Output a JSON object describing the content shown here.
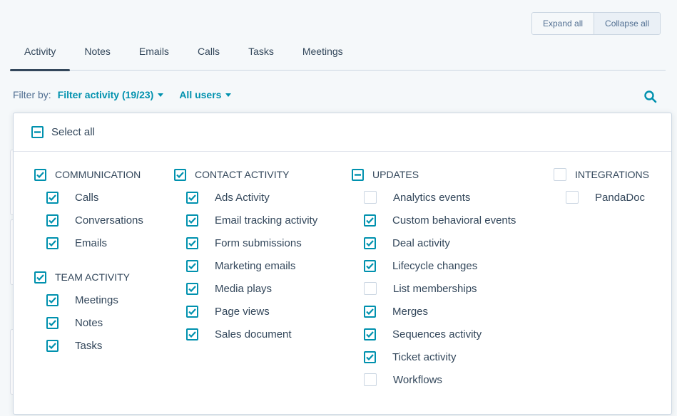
{
  "header": {
    "expand_all": "Expand all",
    "collapse_all": "Collapse all"
  },
  "tabs": [
    {
      "label": "Activity",
      "active": true
    },
    {
      "label": "Notes"
    },
    {
      "label": "Emails"
    },
    {
      "label": "Calls"
    },
    {
      "label": "Tasks"
    },
    {
      "label": "Meetings"
    }
  ],
  "filter": {
    "label": "Filter by:",
    "activity": "Filter activity (19/23)",
    "users": "All users"
  },
  "icons": {
    "search": "search-icon",
    "checked": "checkmark-icon",
    "partial": "minus-icon"
  },
  "colors": {
    "accent": "#0091ae",
    "text": "#33475b",
    "border": "#cbd6e2"
  },
  "panel": {
    "select_all": {
      "label": "Select all",
      "state": "partial"
    },
    "groups": {
      "communication": {
        "title": "COMMUNICATION",
        "state": "checked",
        "items": [
          {
            "label": "Calls",
            "checked": true
          },
          {
            "label": "Conversations",
            "checked": true
          },
          {
            "label": "Emails",
            "checked": true
          }
        ]
      },
      "team_activity": {
        "title": "TEAM ACTIVITY",
        "state": "checked",
        "items": [
          {
            "label": "Meetings",
            "checked": true
          },
          {
            "label": "Notes",
            "checked": true
          },
          {
            "label": "Tasks",
            "checked": true
          }
        ]
      },
      "contact_activity": {
        "title": "CONTACT ACTIVITY",
        "state": "checked",
        "items": [
          {
            "label": "Ads Activity",
            "checked": true
          },
          {
            "label": "Email tracking activity",
            "checked": true
          },
          {
            "label": "Form submissions",
            "checked": true
          },
          {
            "label": "Marketing emails",
            "checked": true
          },
          {
            "label": "Media plays",
            "checked": true
          },
          {
            "label": "Page views",
            "checked": true
          },
          {
            "label": "Sales document",
            "checked": true
          }
        ]
      },
      "updates": {
        "title": "UPDATES",
        "state": "partial",
        "items": [
          {
            "label": "Analytics events",
            "checked": false
          },
          {
            "label": "Custom behavioral events",
            "checked": true
          },
          {
            "label": "Deal activity",
            "checked": true
          },
          {
            "label": "Lifecycle changes",
            "checked": true
          },
          {
            "label": "List memberships",
            "checked": false
          },
          {
            "label": "Merges",
            "checked": true
          },
          {
            "label": "Sequences activity",
            "checked": true
          },
          {
            "label": "Ticket activity",
            "checked": true
          },
          {
            "label": "Workflows",
            "checked": false
          }
        ]
      },
      "integrations": {
        "title": "INTEGRATIONS",
        "state": "empty",
        "items": [
          {
            "label": "PandaDoc",
            "checked": false
          }
        ]
      }
    }
  }
}
